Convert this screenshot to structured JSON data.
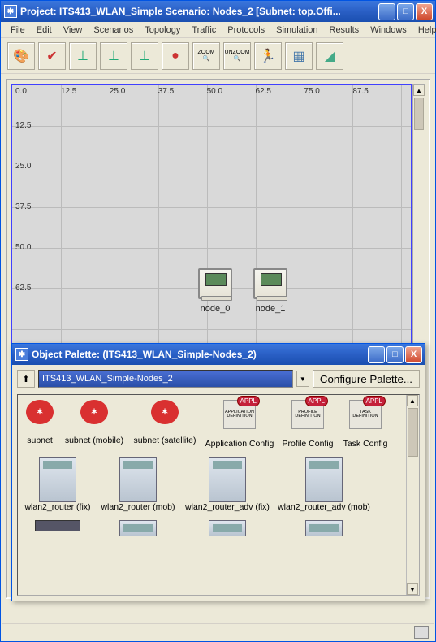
{
  "main_window": {
    "title": "Project: ITS413_WLAN_Simple Scenario: Nodes_2  [Subnet: top.Offi...",
    "min_label": "_",
    "max_label": "□",
    "close_label": "X"
  },
  "menu": {
    "file": "File",
    "edit": "Edit",
    "view": "View",
    "scenarios": "Scenarios",
    "topology": "Topology",
    "traffic": "Traffic",
    "protocols": "Protocols",
    "simulation": "Simulation",
    "results": "Results",
    "windows": "Windows",
    "help": "Help"
  },
  "toolbar": {
    "zoom_label": "ZOOM",
    "unzoom_label": "UNZOOM"
  },
  "ruler": {
    "h": [
      "0.0",
      "12.5",
      "25.0",
      "37.5",
      "50.0",
      "62.5",
      "75.0",
      "87.5"
    ],
    "v": [
      "12.5",
      "25.0",
      "37.5",
      "50.0",
      "62.5"
    ]
  },
  "nodes": {
    "n0": "node_0",
    "n1": "node_1"
  },
  "palette": {
    "title": "Object Palette: (ITS413_WLAN_Simple-Nodes_2)",
    "combo_value": "ITS413_WLAN_Simple-Nodes_2",
    "configure_btn": "Configure Palette...",
    "min_label": "_",
    "max_label": "□",
    "close_label": "X",
    "badge": "APPL",
    "row1": {
      "subnet": "subnet",
      "subnet_mobile": "subnet (mobile)",
      "subnet_satellite": "subnet (satellite)",
      "app_cfg_sub": "APPLICATION DEFINITION",
      "app_cfg": "Application Config",
      "prof_cfg_sub": "PROFILE DEFINITION",
      "prof_cfg": "Profile Config",
      "task_cfg_sub": "TASK DEFINITION",
      "task_cfg": "Task Config"
    },
    "row2": {
      "r1": "wlan2_router (fix)",
      "r2": "wlan2_router (mob)",
      "r3": "wlan2_router_adv (fix)",
      "r4": "wlan2_router_adv (mob)"
    }
  }
}
